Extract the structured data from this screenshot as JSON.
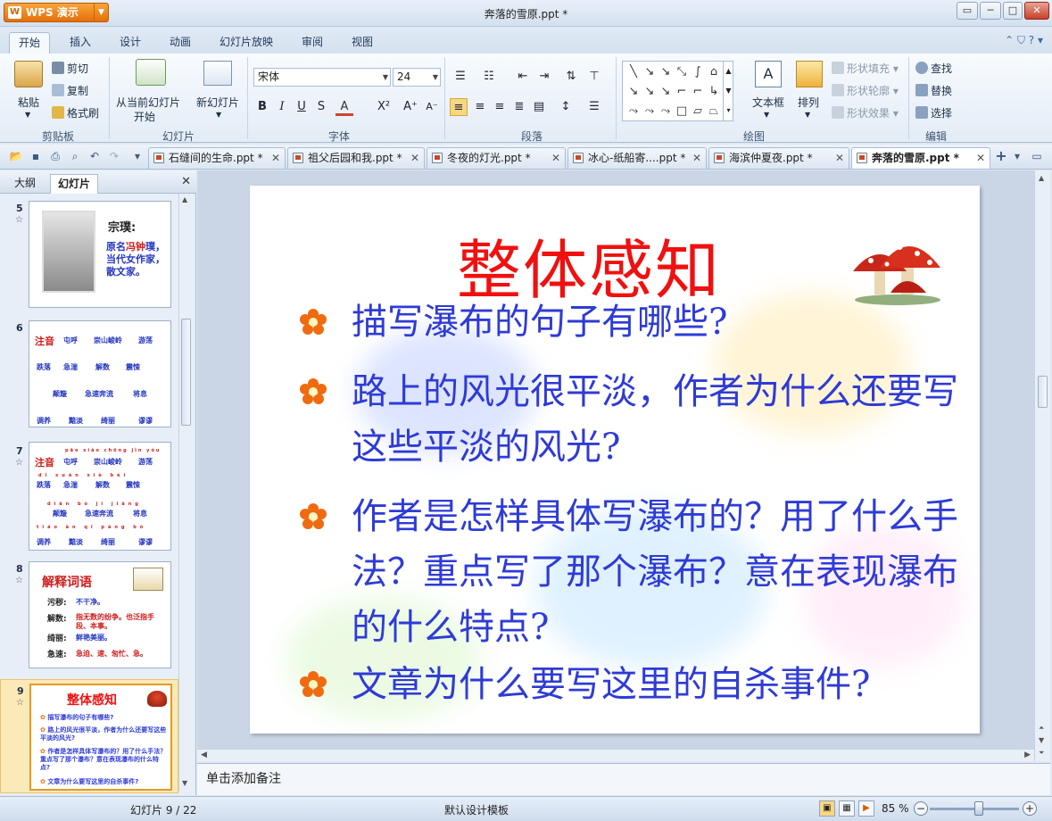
{
  "app": {
    "name": "WPS 演示",
    "logo": "W",
    "doc_title": "奔落的雪原.ppt *"
  },
  "window_controls": [
    "▭",
    "─",
    "□",
    "✕"
  ],
  "ribbon_tabs": [
    "开始",
    "插入",
    "设计",
    "动画",
    "幻灯片放映",
    "审阅",
    "视图"
  ],
  "ribbon_right": "⌃ ⛉ ? ▾",
  "ribbon": {
    "clipboard": {
      "paste": "粘贴",
      "cut": "剪切",
      "copy": "复制",
      "format_painter": "格式刷",
      "label": "剪贴板"
    },
    "slides": {
      "from_current": "从当前幻灯片",
      "start": "开始",
      "new_slide": "新幻灯片",
      "label": "幻灯片"
    },
    "font": {
      "name": "宋体",
      "size": "24",
      "label": "字体"
    },
    "paragraph": {
      "label": "段落"
    },
    "drawing": {
      "textbox": "文本框",
      "arrange": "排列",
      "shape_fill": "形状填充",
      "shape_outline": "形状轮廓",
      "shape_effect": "形状效果",
      "label": "绘图"
    },
    "edit": {
      "find": "查找",
      "replace": "替换",
      "select": "选择",
      "label": "编辑"
    }
  },
  "doc_tabs": [
    {
      "label": "石缝间的生命.ppt *"
    },
    {
      "label": "祖父后园和我.ppt *"
    },
    {
      "label": "冬夜的灯光.ppt *"
    },
    {
      "label": "冰心-纸船寄....ppt *"
    },
    {
      "label": "海滨仲夏夜.ppt *"
    },
    {
      "label": "奔落的雪原.ppt *"
    }
  ],
  "left_pane": {
    "tab_outline": "大纲",
    "tab_slides": "幻灯片"
  },
  "thumbnails": {
    "t5": {
      "num": "5",
      "title": "宗璞:",
      "body1": "原名",
      "body_red": "冯钟",
      "body2": "璞，当代女作家，散文家。"
    },
    "t6": {
      "num": "6",
      "label": "注音",
      "w1": "屯呼",
      "w2": "崇山峻岭",
      "w3": "游荡",
      "w4": "跌落",
      "w5": "急湍",
      "w6": "解数",
      "w7": "震悚",
      "w8": "颠簸",
      "w9": "急速奔流",
      "w10": "将息",
      "w11": "调养",
      "w12": "黯淡",
      "w13": "绮丽",
      "w14": "谬谬"
    },
    "t7": {
      "num": "7",
      "label": "注音",
      "p1": "pāo xiào chōng jǐn yóu",
      "p2": "dǐ xuán xiè bèi",
      "p3": "diān bò jí jiāng",
      "p4": "tiáo àn qǐ páng bó",
      "w1": "屯呼",
      "w2": "崇山峻岭",
      "w3": "游荡",
      "w4": "跌落",
      "w5": "急湍",
      "w6": "解数",
      "w7": "震悚",
      "w8": "颠簸",
      "w9": "急速奔流",
      "w10": "将息",
      "w11": "调养",
      "w12": "黯淡",
      "w13": "绮丽",
      "w14": "谬谬"
    },
    "t8": {
      "num": "8",
      "title": "解释词语",
      "k1": "污秽:",
      "v1": "不干净。",
      "k2": "解数:",
      "v2": "指无数的纷争。也泛指手段、本事。",
      "k3": "绮丽:",
      "v3": "鲜艳美丽。",
      "k4": "急速:",
      "v4": "急迫、速、匆忙、急。"
    },
    "t9": {
      "num": "9",
      "title": "整体感知",
      "b1": "描写瀑布的句子有哪些?",
      "b2": "路上的风光很平淡，作者为什么还要写这些平淡的风光?",
      "b3": "作者是怎样具体写瀑布的？用了什么手法？重点写了那个瀑布？意在表现瀑布的什么特点?",
      "b4": "文章为什么要写这里的自杀事件?"
    }
  },
  "slide": {
    "title": "整体感知",
    "bullets": [
      "描写瀑布的句子有哪些?",
      "路上的风光很平淡，作者为什么还要写这些平淡的风光?",
      "作者是怎样具体写瀑布的？用了什么手法？重点写了那个瀑布？意在表现瀑布的什么特点?",
      "文章为什么要写这里的自杀事件?"
    ],
    "colors": {
      "title": "#f01010",
      "bullet": "#2e3bd6",
      "flower": "#f06a10"
    }
  },
  "notes_placeholder": "单击添加备注",
  "status": {
    "slide_pos": "幻灯片 9 / 22",
    "template": "默认设计模板",
    "zoom": "85 %",
    "zoom_level": 0.55
  }
}
